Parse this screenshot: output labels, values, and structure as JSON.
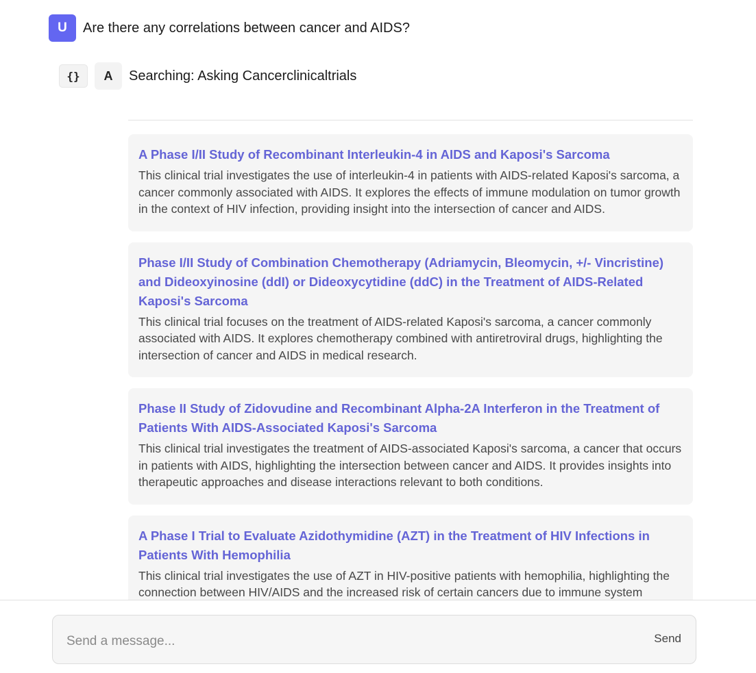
{
  "user_message": {
    "avatar_letter": "U",
    "text": "Are there any correlations between cancer and AIDS?"
  },
  "assistant": {
    "json_toggle_label": "{}",
    "avatar_letter": "A",
    "status_text": "Searching: Asking Cancerclinicaltrials"
  },
  "results": [
    {
      "title": "A Phase I/II Study of Recombinant Interleukin-4 in AIDS and Kaposi's Sarcoma",
      "description": "This clinical trial investigates the use of interleukin-4 in patients with AIDS-related Kaposi's sarcoma, a cancer commonly associated with AIDS. It explores the effects of immune modulation on tumor growth in the context of HIV infection, providing insight into the intersection of cancer and AIDS."
    },
    {
      "title": "Phase I/II Study of Combination Chemotherapy (Adriamycin, Bleomycin, +/- Vincristine) and Dideoxyinosine (ddI) or Dideoxycytidine (ddC) in the Treatment of AIDS-Related Kaposi's Sarcoma",
      "description": "This clinical trial focuses on the treatment of AIDS-related Kaposi's sarcoma, a cancer commonly associated with AIDS. It explores chemotherapy combined with antiretroviral drugs, highlighting the intersection of cancer and AIDS in medical research."
    },
    {
      "title": "Phase II Study of Zidovudine and Recombinant Alpha-2A Interferon in the Treatment of Patients With AIDS-Associated Kaposi's Sarcoma",
      "description": "This clinical trial investigates the treatment of AIDS-associated Kaposi's sarcoma, a cancer that occurs in patients with AIDS, highlighting the intersection between cancer and AIDS. It provides insights into therapeutic approaches and disease interactions relevant to both conditions."
    },
    {
      "title": "A Phase I Trial to Evaluate Azidothymidine (AZT) in the Treatment of HIV Infections in Patients With Hemophilia",
      "description": "This clinical trial investigates the use of AZT in HIV-positive patients with hemophilia, highlighting the connection between HIV/AIDS and the increased risk of certain cancers due to immune system"
    }
  ],
  "composer": {
    "placeholder": "Send a message...",
    "value": "",
    "send_label": "Send"
  },
  "colors": {
    "accent": "#6366f1",
    "link": "#6464d6",
    "card_bg": "#f5f5f5"
  }
}
